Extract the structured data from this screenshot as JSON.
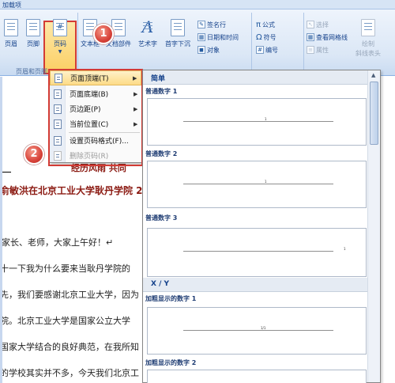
{
  "ribbon": {
    "tab_label": "加载项",
    "buttons": {
      "header": "页眉",
      "footer": "页脚",
      "page_number": "页码",
      "textbox": "文本框",
      "quick_parts": "文档部件",
      "wordart": "艺术字",
      "dropcap": "首字下沉"
    },
    "group_header_footer": "页眉和页脚",
    "text_group": {
      "signature_line": "签名行",
      "date_time": "日期和时间",
      "object": "对象"
    },
    "symbols_group": {
      "equation": "公式",
      "symbol": "符号",
      "number": "编号"
    },
    "filter_group": {
      "select": "选择",
      "view_gridlines": "查看网格线",
      "properties": "属性",
      "draw_table": "绘制",
      "slash_header": "斜线表头"
    }
  },
  "callouts": [
    "1",
    "2"
  ],
  "menu": {
    "items": [
      {
        "label": "页面顶端(T)",
        "has_submenu": true,
        "active": true
      },
      {
        "label": "页面底端(B)",
        "has_submenu": true
      },
      {
        "label": "页边距(P)",
        "has_submenu": true
      },
      {
        "label": "当前位置(C)",
        "has_submenu": true
      },
      {
        "label": "设置页码格式(F)...",
        "has_submenu": false
      },
      {
        "label": "删除页码(R)",
        "has_submenu": false,
        "disabled": true
      }
    ]
  },
  "gallery": {
    "section_simple": "简单",
    "items": [
      {
        "label": "普通数字 1",
        "number": "1"
      },
      {
        "label": "普通数字 2",
        "number": "1"
      },
      {
        "label": "普通数字 3",
        "number": "1"
      }
    ],
    "section_xy": "X / Y",
    "bold_items": [
      {
        "label": "加粗显示的数字 1",
        "number": "1/1"
      },
      {
        "label": "加粗显示的数字 2",
        "number": ""
      }
    ]
  },
  "document": {
    "lines": [
      "经历风雨  共同",
      "俞敏洪在北京工业大学耿丹学院 2",
      "家长、老师，大家上午好！↵",
      "十一下我为什么要来当耿丹学院的",
      "先，我们要感谢北京工业大学，因为",
      "院。北京工业大学是国家公立大学",
      "国家大学结合的良好典范，在我所知",
      "的学校其实并不多，今天我们北京工"
    ]
  }
}
